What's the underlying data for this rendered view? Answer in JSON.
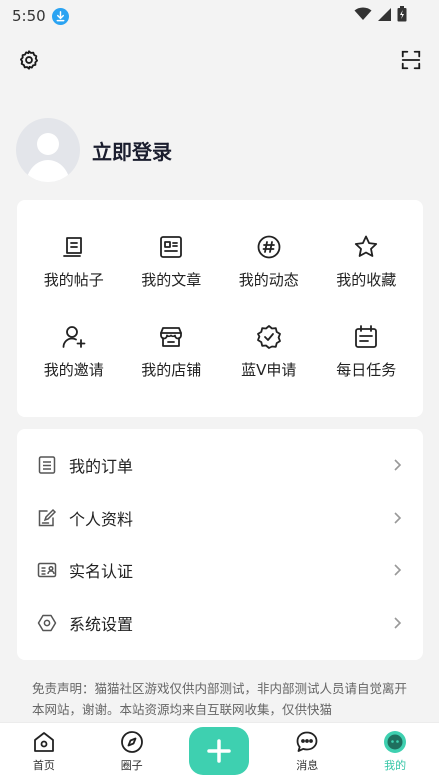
{
  "status_bar": {
    "time": "5:50"
  },
  "profile": {
    "login_text": "立即登录"
  },
  "grid": [
    {
      "label": "我的帖子",
      "icon": "posts-icon"
    },
    {
      "label": "我的文章",
      "icon": "article-icon"
    },
    {
      "label": "我的动态",
      "icon": "hashtag-icon"
    },
    {
      "label": "我的收藏",
      "icon": "star-icon"
    },
    {
      "label": "我的邀请",
      "icon": "invite-user-icon"
    },
    {
      "label": "我的店铺",
      "icon": "shop-icon"
    },
    {
      "label": "蓝V申请",
      "icon": "verified-badge-icon"
    },
    {
      "label": "每日任务",
      "icon": "calendar-task-icon"
    }
  ],
  "list": [
    {
      "label": "我的订单",
      "icon": "order-list-icon"
    },
    {
      "label": "个人资料",
      "icon": "edit-profile-icon"
    },
    {
      "label": "实名认证",
      "icon": "id-card-icon"
    },
    {
      "label": "系统设置",
      "icon": "hexagon-settings-icon"
    }
  ],
  "disclaimer": "免责声明：猫猫社区游戏仅供内部测试，非内部测试人员请自觉离开本网站，谢谢。本站资源均来自互联网收集，仅供快猫",
  "tabbar": {
    "items": [
      {
        "label": "首页",
        "icon": "home-icon"
      },
      {
        "label": "圈子",
        "icon": "compass-icon"
      },
      {
        "label": "消息",
        "icon": "message-icon"
      },
      {
        "label": "我的",
        "icon": "mine-icon"
      }
    ],
    "active": "我的"
  },
  "colors": {
    "accent": "#3ed0b0",
    "active_tab": "#35c6a6",
    "background": "#f3f3f3"
  }
}
